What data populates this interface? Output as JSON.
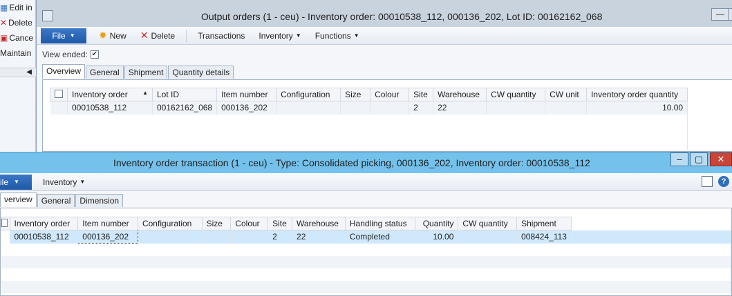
{
  "background_window": {
    "items": [
      "Edit in",
      "Delete",
      "Cance",
      "Maintain"
    ]
  },
  "window1": {
    "title": "Output orders (1 - ceu) - Inventory order: 00010538_112, 000136_202, Lot ID: 00162162_068",
    "file_label": "File",
    "toolbar": {
      "new_label": "New",
      "delete_label": "Delete",
      "transactions_label": "Transactions",
      "inventory_label": "Inventory",
      "functions_label": "Functions"
    },
    "view_ended_label": "View ended:",
    "view_ended_checked": true,
    "tabs": [
      "Overview",
      "General",
      "Shipment",
      "Quantity details"
    ],
    "grid": {
      "columns": [
        "Inventory order",
        "Lot ID",
        "Item number",
        "Configuration",
        "Size",
        "Colour",
        "Site",
        "Warehouse",
        "CW quantity",
        "CW unit",
        "Inventory order quantity"
      ],
      "rows": [
        [
          "00010538_112",
          "00162162_068",
          "000136_202",
          "",
          "",
          "",
          "2",
          "22",
          "",
          "",
          "10.00"
        ]
      ]
    }
  },
  "window2": {
    "title": "Inventory order transaction (1 - ceu) - Type: Consolidated picking, 000136_202, Inventory order: 00010538_112",
    "file_label": "ile",
    "toolbar": {
      "inventory_label": "Inventory"
    },
    "tabs": [
      "verview",
      "General",
      "Dimension"
    ],
    "grid": {
      "columns": [
        "Inventory order",
        "Item number",
        "Configuration",
        "Size",
        "Colour",
        "Site",
        "Warehouse",
        "Handling status",
        "Quantity",
        "CW quantity",
        "Shipment"
      ],
      "rows": [
        [
          "00010538_112",
          "000136_202",
          "",
          "",
          "",
          "2",
          "22",
          "Completed",
          "10.00",
          "",
          "008424_113"
        ]
      ]
    }
  },
  "colors": {
    "title_active": "#74c2ec",
    "title_inactive": "#c9d3de",
    "file_button": "#1f59a8",
    "selected_row": "#cfe8fb"
  }
}
